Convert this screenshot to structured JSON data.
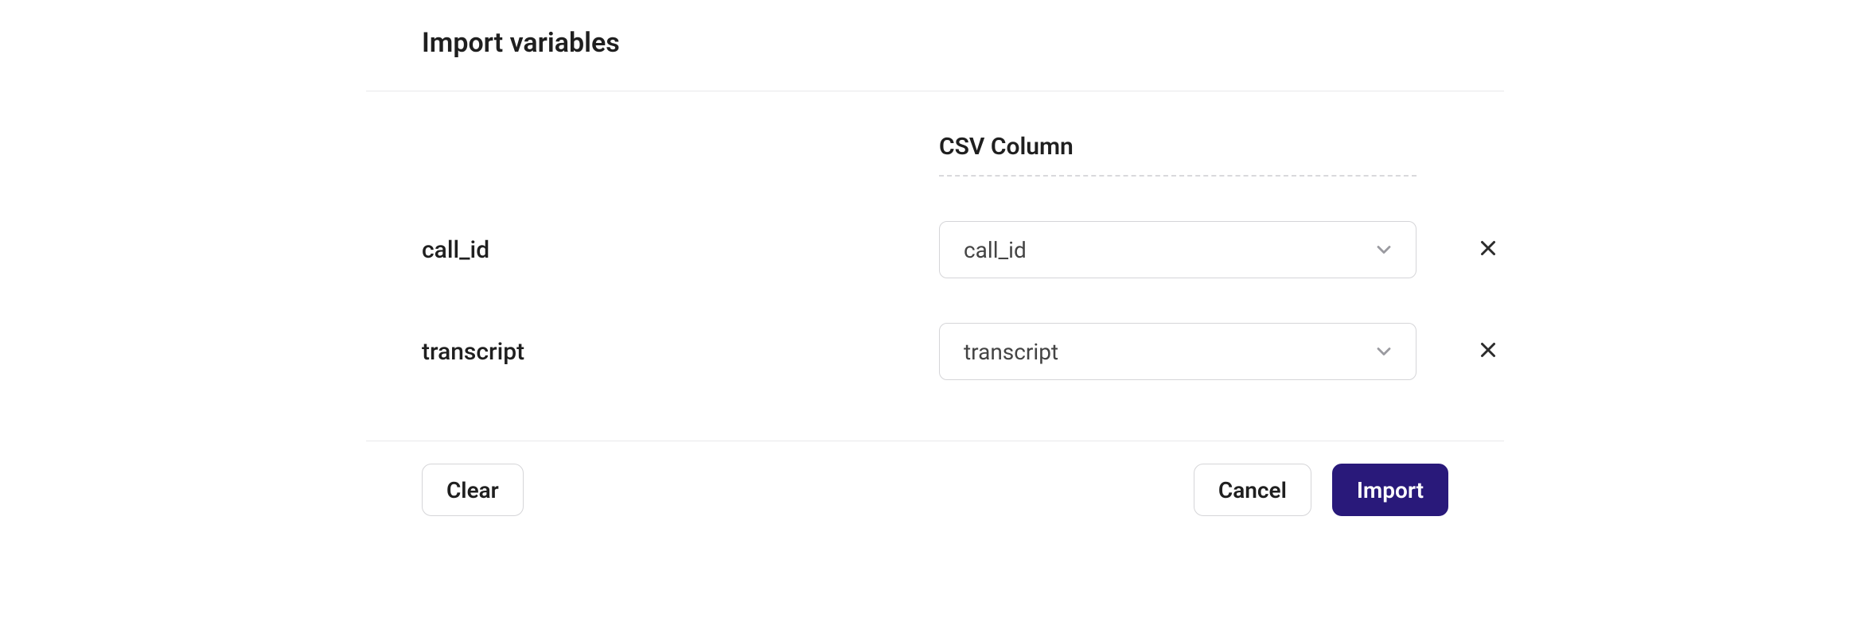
{
  "dialog": {
    "title": "Import variables",
    "column_header": "CSV Column",
    "rows": [
      {
        "variable": "call_id",
        "selected": "call_id"
      },
      {
        "variable": "transcript",
        "selected": "transcript"
      }
    ],
    "buttons": {
      "clear": "Clear",
      "cancel": "Cancel",
      "import": "Import"
    }
  }
}
